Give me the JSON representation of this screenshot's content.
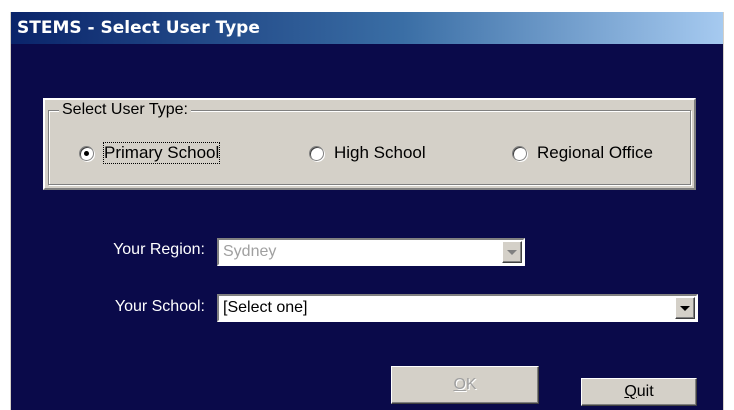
{
  "window": {
    "title": "STEMS - Select User Type"
  },
  "user_type_group": {
    "legend": "Select User Type:",
    "options": [
      {
        "label": "Primary School",
        "checked": true,
        "focused": true
      },
      {
        "label": "High School",
        "checked": false,
        "focused": false
      },
      {
        "label": "Regional Office",
        "checked": false,
        "focused": false
      }
    ]
  },
  "region": {
    "label": "Your Region:",
    "value": "Sydney",
    "enabled": false
  },
  "school": {
    "label": "Your School:",
    "value": "[Select one]",
    "enabled": true
  },
  "buttons": {
    "ok": {
      "mnemonic": "O",
      "rest": "K",
      "enabled": false
    },
    "quit": {
      "mnemonic": "Q",
      "rest": "uit",
      "enabled": true
    }
  },
  "colors": {
    "client_background": "#0a0a4a",
    "titlebar_start": "#0a246a",
    "titlebar_end": "#a6caf0",
    "dialog_face": "#d4d0c8"
  }
}
